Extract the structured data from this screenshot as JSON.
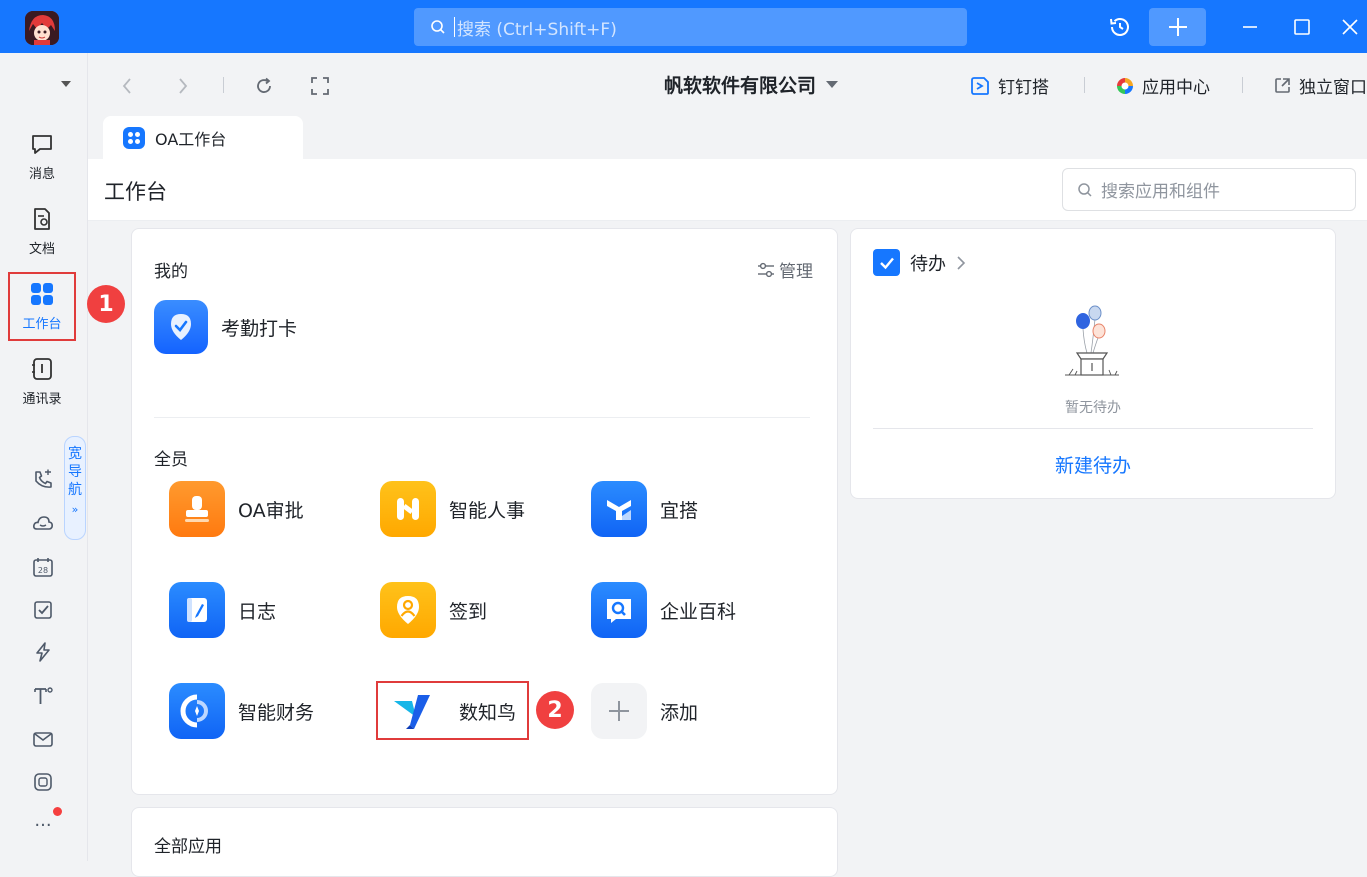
{
  "titlebar": {
    "search_placeholder": "搜索 (Ctrl+Shift+F)"
  },
  "rail": {
    "items": [
      {
        "label": "消息",
        "icon": "chat-bubble-icon"
      },
      {
        "label": "文档",
        "icon": "document-icon"
      },
      {
        "label": "工作台",
        "icon": "grid-apps-icon"
      },
      {
        "label": "通讯录",
        "icon": "contacts-book-icon"
      }
    ],
    "wide_nav": [
      "宽",
      "导",
      "航"
    ],
    "wide_nav_chevron": "»",
    "calendar_day": "28",
    "more": "···",
    "extra_icons": [
      "phone-icon",
      "cloud-icon",
      "calendar-icon",
      "task-check-icon",
      "lightning-icon",
      "text-format-icon",
      "mail-icon",
      "dingtalk-box-icon"
    ]
  },
  "nav": {
    "company": "帆软软件有限公司",
    "links": [
      "钉钉搭",
      "应用中心",
      "独立窗口"
    ]
  },
  "tab": {
    "label": "OA工作台"
  },
  "page": {
    "title": "工作台",
    "search_placeholder": "搜索应用和组件"
  },
  "mine": {
    "title": "我的",
    "manage": "管理",
    "apps": [
      {
        "label": "考勤打卡",
        "icon": "attendance-shield-icon"
      }
    ]
  },
  "all_members": {
    "title": "全员",
    "apps": [
      {
        "label": "OA审批",
        "icon": "approval-stamp-icon"
      },
      {
        "label": "智能人事",
        "icon": "hr-h-icon"
      },
      {
        "label": "宜搭",
        "icon": "yida-icon"
      },
      {
        "label": "日志",
        "icon": "journal-icon"
      },
      {
        "label": "签到",
        "icon": "checkin-pin-icon"
      },
      {
        "label": "企业百科",
        "icon": "wiki-search-icon"
      },
      {
        "label": "智能财务",
        "icon": "finance-icon"
      },
      {
        "label": "数知鸟",
        "icon": "shuzhiniao-icon"
      },
      {
        "label": "添加",
        "icon": "add-icon"
      }
    ]
  },
  "todo": {
    "title": "待办",
    "empty": "暂无待办",
    "new_button": "新建待办"
  },
  "all_apps": {
    "title": "全部应用"
  },
  "badges": [
    "1",
    "2"
  ],
  "colors": {
    "primary": "#1677ff",
    "highlight_red": "#e03b3b",
    "orange": "#ff8a1f",
    "yellow": "#ffb400"
  }
}
